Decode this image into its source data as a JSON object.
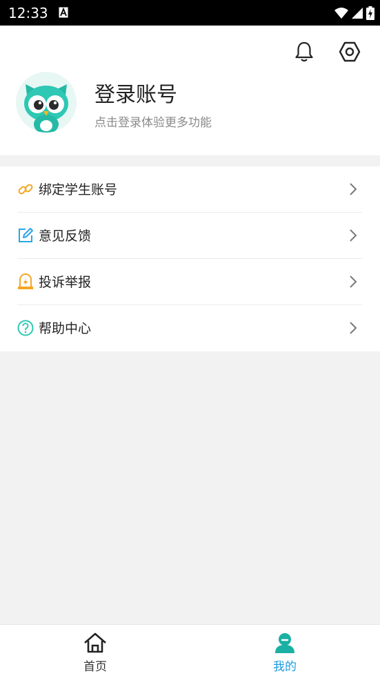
{
  "status_bar": {
    "time": "12:33"
  },
  "profile": {
    "title": "登录账号",
    "subtitle": "点击登录体验更多功能"
  },
  "menu": {
    "items": [
      {
        "label": "绑定学生账号",
        "icon": "link-icon",
        "color": "#f5a623"
      },
      {
        "label": "意见反馈",
        "icon": "edit-icon",
        "color": "#29a6e8"
      },
      {
        "label": "投诉举报",
        "icon": "alert-lamp-icon",
        "color": "#f5a623"
      },
      {
        "label": "帮助中心",
        "icon": "help-icon",
        "color": "#2ec8b4"
      }
    ]
  },
  "tabbar": {
    "tabs": [
      {
        "label": "首页",
        "icon": "home-icon",
        "active": false
      },
      {
        "label": "我的",
        "icon": "profile-icon",
        "active": true
      }
    ],
    "active_color": "#1ab0a3",
    "inactive_color": "#333333"
  }
}
